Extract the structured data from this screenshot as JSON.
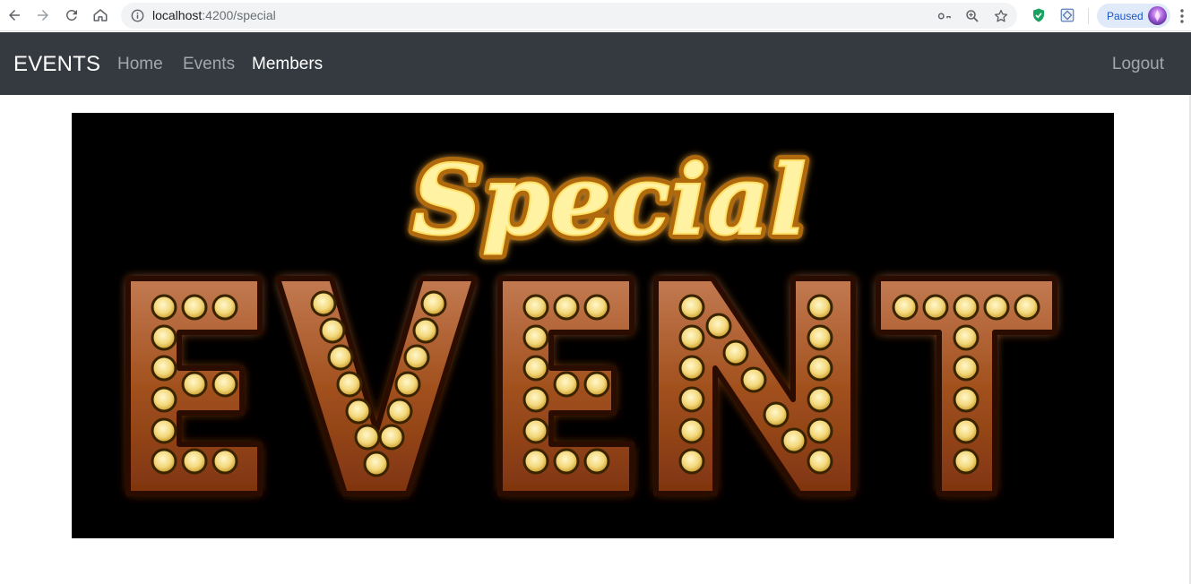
{
  "browser": {
    "url_host": "localhost",
    "url_rest": ":4200/special",
    "profile_status": "Paused",
    "icons": {
      "back": "arrow-left-icon",
      "forward": "arrow-right-icon",
      "reload": "reload-icon",
      "home": "home-icon",
      "site_info": "info-icon",
      "passwords": "key-icon",
      "zoom": "zoom-icon",
      "bookmark": "star-icon",
      "extension_1": "shield-check-icon",
      "extension_2": "extension-icon",
      "menu": "kebab-menu-icon"
    }
  },
  "navbar": {
    "brand": "EVENTS",
    "links": [
      {
        "label": "Home",
        "active": false
      },
      {
        "label": "Events",
        "active": false
      },
      {
        "label": "Members",
        "active": true
      }
    ],
    "logout": "Logout",
    "background": "#343a40"
  },
  "banner": {
    "script_text": "Special",
    "marquee_text": "EVENT",
    "colors": {
      "background": "#000000",
      "script_fill": "#fff3a3",
      "script_outline": "#b06a08",
      "letter_fill": "#a2511e",
      "glow": "#ff7a1a",
      "bulb": "#f7e58d"
    }
  }
}
